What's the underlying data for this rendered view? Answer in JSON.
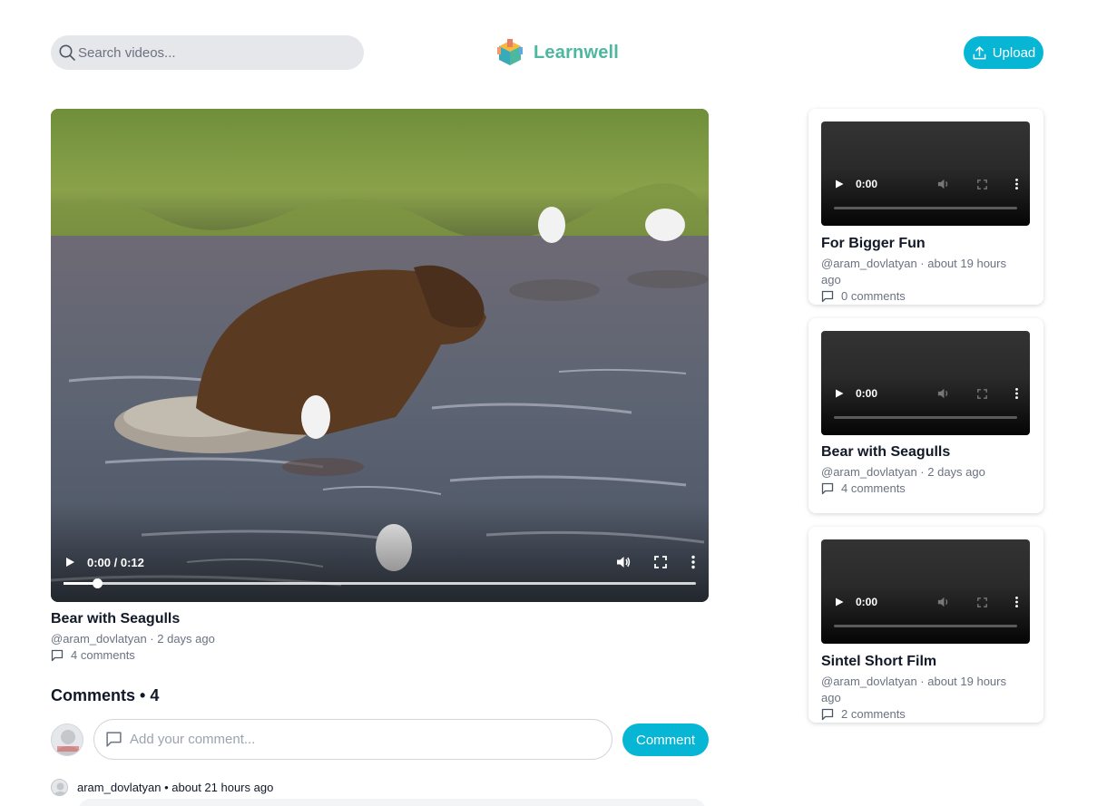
{
  "header": {
    "search_placeholder": "Search videos...",
    "logo_text": "Learnwell",
    "upload_label": "Upload"
  },
  "main_video": {
    "current_time": "0:00",
    "duration": "0:12",
    "time_display": "0:00 / 0:12",
    "progress_fraction": 0,
    "title": "Bear with Seagulls",
    "author": "@aram_dovlatyan",
    "posted": "2 days ago",
    "meta": "@aram_dovlatyan · 2 days ago",
    "comments_label": "4 comments"
  },
  "comments_section": {
    "heading": "Comments • 4",
    "input_placeholder": "Add your comment...",
    "submit_label": "Comment",
    "items": [
      {
        "author": "aram_dovlatyan",
        "time": "about 21 hours ago",
        "header": "aram_dovlatyan • about 21 hours ago"
      }
    ]
  },
  "sidebar": {
    "videos": [
      {
        "time": "0:00",
        "title": "For Bigger Fun",
        "meta": "@aram_dovlatyan · about 19 hours ago",
        "comments_label": "0 comments"
      },
      {
        "time": "0:00",
        "title": "Bear with Seagulls",
        "meta": "@aram_dovlatyan · 2 days ago",
        "comments_label": "4 comments"
      },
      {
        "time": "0:00",
        "title": "Sintel Short Film",
        "meta": "@aram_dovlatyan · about 19 hours ago",
        "comments_label": "2 comments"
      }
    ]
  },
  "colors": {
    "accent": "#06b6d4",
    "logo": "#4cb8a0",
    "search_bg": "#e5e7eb",
    "text_muted": "#6b7280"
  },
  "icons": [
    "search-icon",
    "logo-cube-icon",
    "upload-icon",
    "play-icon",
    "volume-icon",
    "fullscreen-icon",
    "more-options-icon",
    "comment-icon"
  ]
}
